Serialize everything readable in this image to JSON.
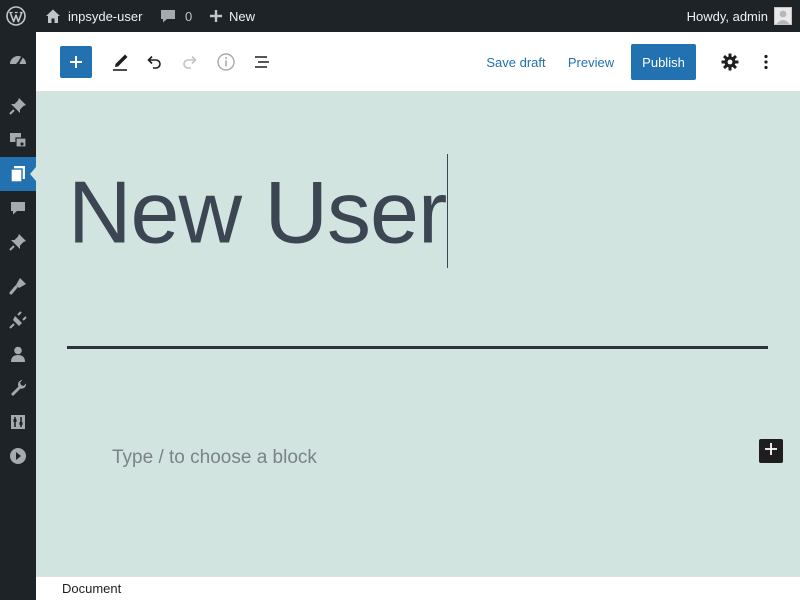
{
  "admin_bar": {
    "site_name": "inpsyde-user",
    "comment_count": "0",
    "new_label": "New",
    "greeting": "Howdy, admin"
  },
  "admin_menu": {
    "icons": [
      "dashboard-icon",
      "posts-icon",
      "media-icon",
      "pages-icon",
      "comments-icon",
      "custom-post-icon",
      "appearance-icon",
      "plugins-icon",
      "users-icon",
      "tools-icon",
      "settings-icon",
      "collapse-icon"
    ],
    "current": "pages-icon"
  },
  "toolbar": {
    "save_draft_label": "Save draft",
    "preview_label": "Preview",
    "publish_label": "Publish"
  },
  "editor": {
    "title": "New User",
    "placeholder": "Type / to choose a block"
  },
  "footer": {
    "breadcrumb": "Document"
  },
  "colors": {
    "accent": "#2271b1",
    "admin_bar": "#1d2327",
    "canvas_bg": "#d2e4df",
    "title_text": "#3c4552"
  }
}
